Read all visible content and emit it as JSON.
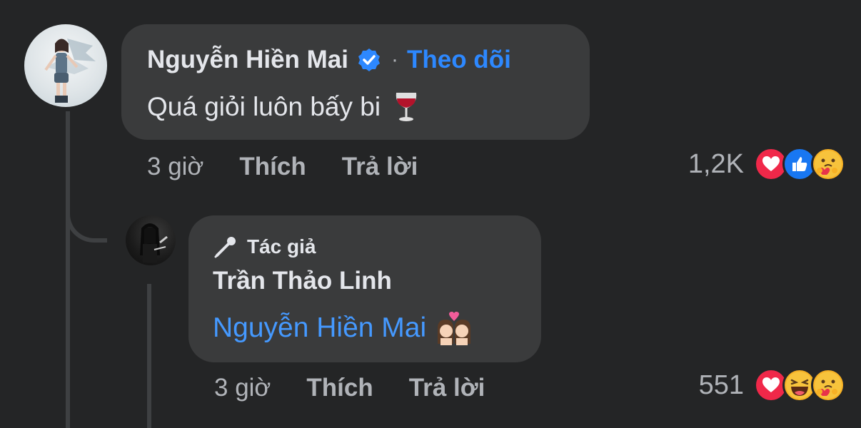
{
  "comment": {
    "author": "Nguyễn Hiền Mai",
    "separator": "·",
    "follow_label": "Theo dõi",
    "text": "Quá giỏi luôn bấy bi",
    "emoji": "wine-glass",
    "time": "3 giờ",
    "like_label": "Thích",
    "reply_label": "Trả lời",
    "reaction_count": "1,2K",
    "reactions": [
      "love",
      "like",
      "care"
    ]
  },
  "reply": {
    "badge": "Tác giả",
    "author": "Trần Thảo Linh",
    "mention": "Nguyễn Hiền Mai",
    "emoji": "kiss-couple",
    "time": "3 giờ",
    "like_label": "Thích",
    "reply_label": "Trả lời",
    "reaction_count": "551",
    "reactions": [
      "love",
      "haha",
      "care"
    ]
  },
  "colors": {
    "background": "#242526",
    "bubble": "#3a3b3c",
    "link": "#2d88ff",
    "mention": "#4599ff",
    "muted": "#b0b3b8"
  }
}
